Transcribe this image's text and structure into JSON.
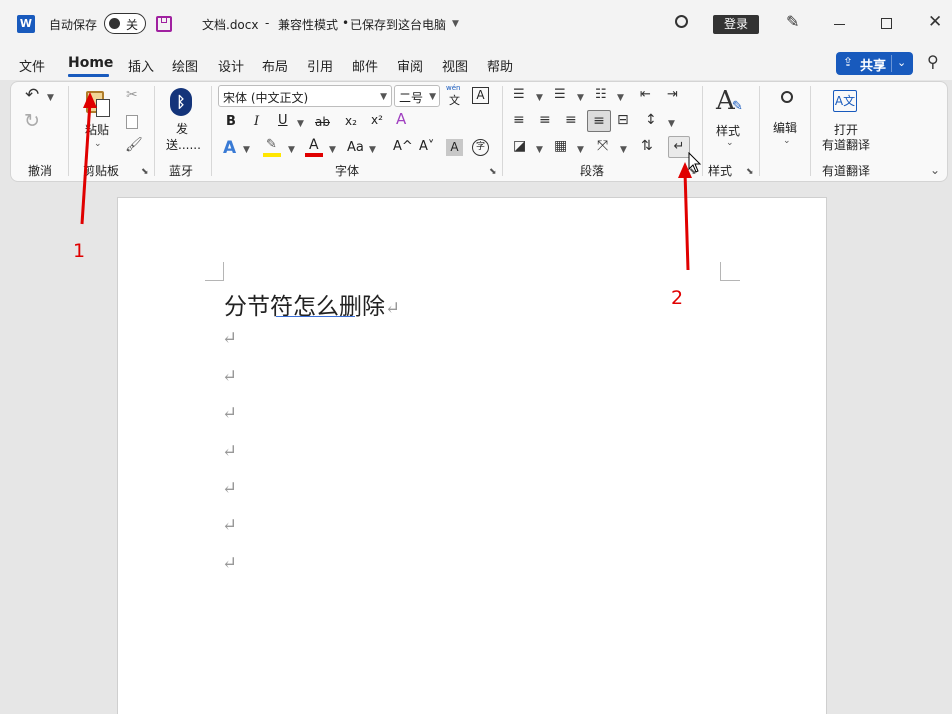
{
  "title_bar": {
    "app_icon": "word-app-icon",
    "autosave_label": "自动保存",
    "autosave_toggle": "关",
    "save_icon": "save-icon",
    "doc_title": "文档.docx",
    "title_sep": "-",
    "compat_mode": "兼容性模式",
    "dot": "•",
    "saved_status": "已保存到这台电脑",
    "login_button": "登录"
  },
  "menu": {
    "items": [
      "文件",
      "Home",
      "插入",
      "绘图",
      "设计",
      "布局",
      "引用",
      "邮件",
      "审阅",
      "视图",
      "帮助"
    ],
    "share_label": "共享"
  },
  "ribbon": {
    "undo": {
      "group_label": "撤消"
    },
    "clipboard": {
      "paste_label": "粘贴",
      "group_label": "剪贴板"
    },
    "bluetooth": {
      "send_label": "发",
      "send_label2": "送......",
      "group_label": "蓝牙"
    },
    "font": {
      "font_name": "宋体 (中文正文)",
      "font_size": "二号",
      "phonetic_top": "wén",
      "phonetic_char": "文",
      "boxed_char": "A",
      "bold": "B",
      "italic": "I",
      "underline": "U",
      "strike": "ab",
      "subscript": "x₂",
      "superscript": "x²",
      "text_effect": "A",
      "highlight": "ab",
      "font_color": "A",
      "change_case": "Aa",
      "grow": "A^",
      "shrink": "A˅",
      "shading": "A",
      "enclose": "字",
      "group_label": "字体"
    },
    "paragraph": {
      "group_label": "段落"
    },
    "styles": {
      "styles_label": "样式",
      "group_label": "样式"
    },
    "editing": {
      "edit_label": "编辑"
    },
    "translate": {
      "open_label": "打开",
      "youdao_label": "有道翻译",
      "group_label": "有道翻译"
    }
  },
  "document": {
    "heading": "分节符怎么删除",
    "para_mark": "↵",
    "empty_paragraphs": 7
  },
  "annotations": {
    "label_1": "1",
    "label_2": "2",
    "color": "#e00000"
  },
  "colors": {
    "accent": "#185abd",
    "highlight_yellow": "#ffe600",
    "font_red": "#e00000",
    "share_blue": "#185abd"
  }
}
